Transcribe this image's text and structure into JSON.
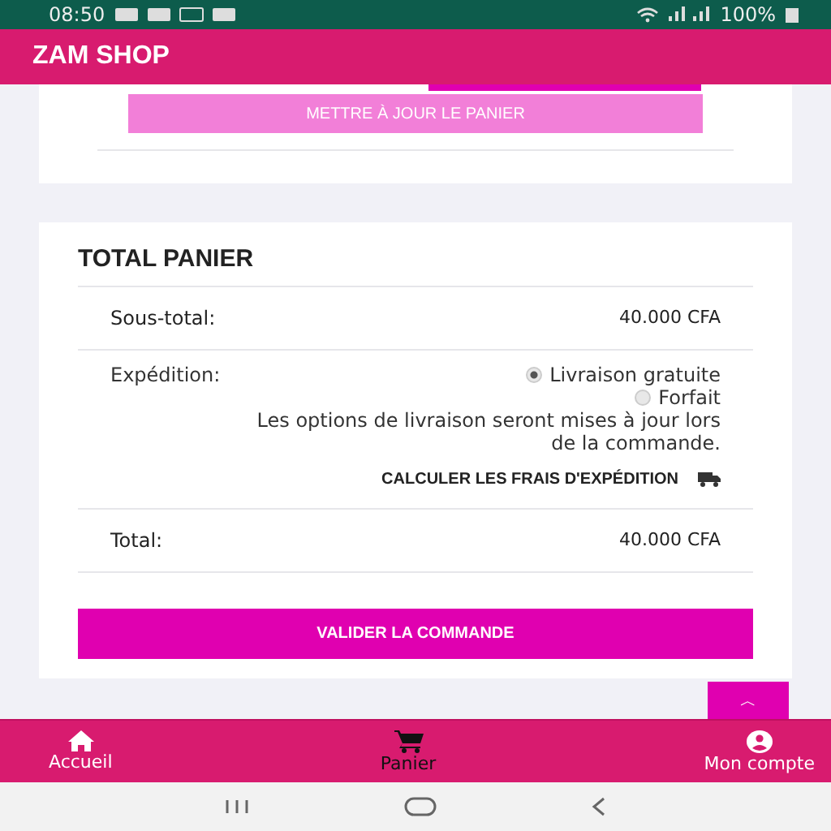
{
  "status_bar": {
    "time": "08:50",
    "battery": "100%"
  },
  "app_bar": {
    "title": "ZAM SHOP"
  },
  "cart_card": {
    "update_button": "METTRE À JOUR LE PANIER"
  },
  "totals": {
    "title": "TOTAL PANIER",
    "subtotal": {
      "label": "Sous-total:",
      "value": "40.000 CFA"
    },
    "shipping": {
      "label": "Expédition:",
      "options": [
        {
          "label": "Livraison gratuite",
          "selected": true
        },
        {
          "label": "Forfait",
          "selected": false
        }
      ],
      "note": "Les options de livraison seront mises à jour lors de la commande.",
      "calculate_link": "CALCULER LES FRAIS D'EXPÉDITION"
    },
    "total": {
      "label": "Total:",
      "value": "40.000 CFA"
    },
    "checkout_button": "VALIDER LA COMMANDE"
  },
  "scroll_top": "︿",
  "bottom_nav": [
    {
      "label": "Accueil",
      "kind": "home",
      "selected": false
    },
    {
      "label": "Panier",
      "kind": "cart",
      "selected": true
    },
    {
      "label": "Mon compte",
      "kind": "account",
      "selected": false
    }
  ]
}
